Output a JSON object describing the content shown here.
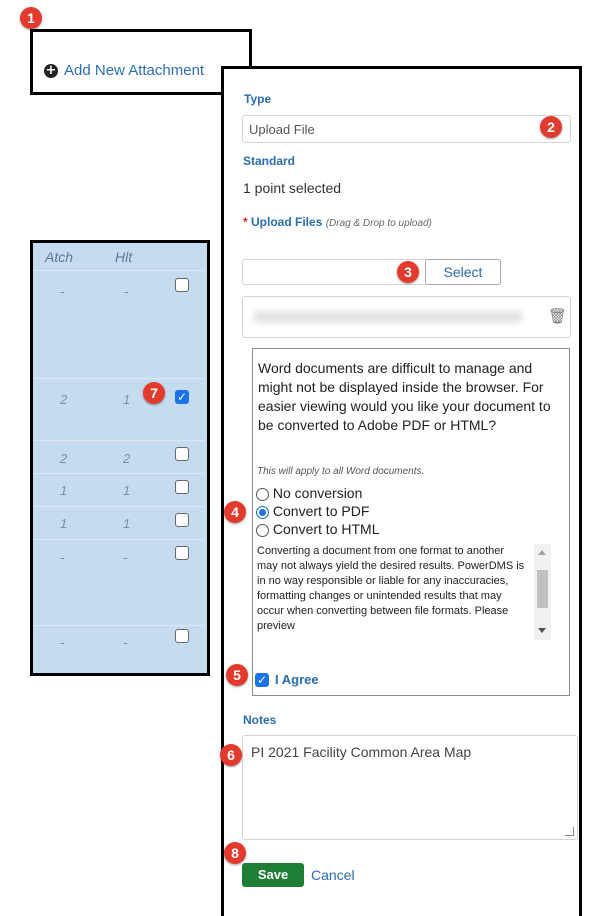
{
  "add_attachment": {
    "label": "Add New Attachment",
    "icon": "plus-circle-icon"
  },
  "form": {
    "type_label": "Type",
    "type_value": "Upload File",
    "standard_label": "Standard",
    "standard_value": "1 point selected",
    "upload_required_mark": "*",
    "upload_label": "Upload Files",
    "upload_hint": "(Drag & Drop to upload)",
    "select_button": "Select",
    "conversion_prompt": "Word documents are difficult to manage and might not be displayed inside the browser. For easier viewing would you like your document to be converted to Adobe PDF or HTML?",
    "conversion_note": "This will apply to all Word documents.",
    "options": [
      {
        "label": "No conversion",
        "selected": false
      },
      {
        "label": "Convert to PDF",
        "selected": true
      },
      {
        "label": "Convert to HTML",
        "selected": false
      }
    ],
    "disclaimer": "Converting a document from one format to another may not always yield the desired results. PowerDMS is in no way responsible or liable for any inaccuracies, formatting changes or unintended results that may occur when converting between file formats. Please preview",
    "agree_label": "I Agree",
    "agree_checked": true,
    "notes_label": "Notes",
    "notes_value": "PI 2021 Facility Common Area Map",
    "save_button": "Save",
    "cancel_link": "Cancel"
  },
  "side_table": {
    "headers": [
      "Atch",
      "Hlt"
    ],
    "rows": [
      {
        "atch": "-",
        "hlt": "-",
        "checked": false
      },
      {
        "atch": "2",
        "hlt": "1",
        "checked": true
      },
      {
        "atch": "2",
        "hlt": "2",
        "checked": false
      },
      {
        "atch": "1",
        "hlt": "1",
        "checked": false
      },
      {
        "atch": "1",
        "hlt": "1",
        "checked": false
      },
      {
        "atch": "-",
        "hlt": "-",
        "checked": false
      },
      {
        "atch": "-",
        "hlt": "-",
        "checked": false
      }
    ]
  },
  "badges": [
    "1",
    "2",
    "3",
    "4",
    "5",
    "6",
    "7",
    "8"
  ],
  "colors": {
    "accent": "#2a6db0",
    "save": "#1e7e34",
    "badge": "#e23b2e",
    "side_bg": "#c5dcf0"
  }
}
